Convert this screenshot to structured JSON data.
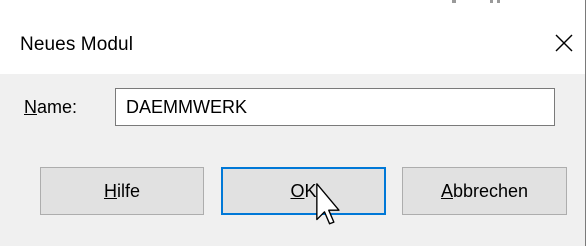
{
  "window": {
    "title": "Neues Modul",
    "close_icon": "close-icon"
  },
  "form": {
    "name_label_mnemonic": "N",
    "name_label_rest": "ame:",
    "name_value": "DAEMMWERK"
  },
  "buttons": {
    "help_mnemonic": "H",
    "help_rest": "ilfe",
    "ok_mnemonic": "O",
    "ok_rest": "K",
    "cancel_mnemonic": "A",
    "cancel_rest": "bbrechen"
  },
  "colors": {
    "focus_border": "#0078d7",
    "dialog_background": "#f0f0f0",
    "button_face": "#e1e1e1"
  }
}
